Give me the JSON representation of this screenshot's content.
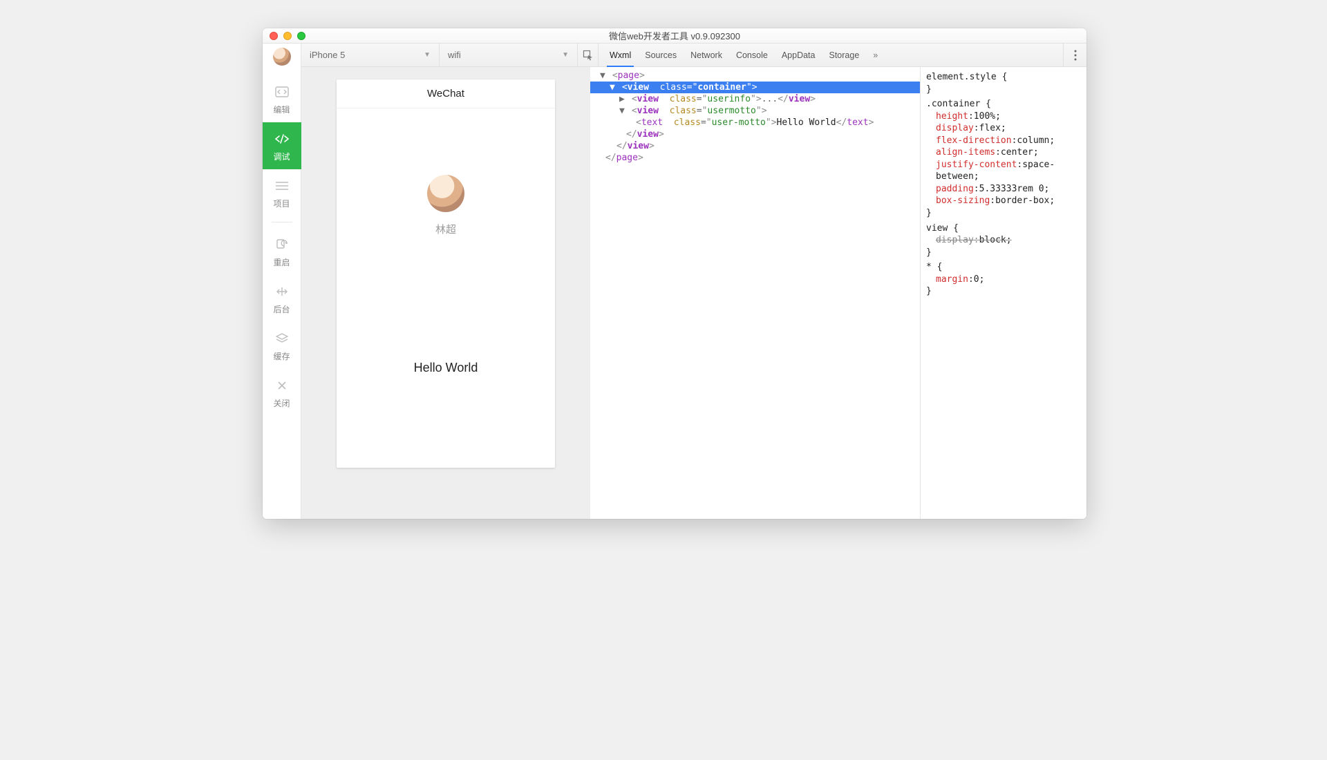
{
  "window": {
    "title": "微信web开发者工具 v0.9.092300"
  },
  "sidebar": {
    "items": [
      {
        "label": "编辑"
      },
      {
        "label": "调试"
      },
      {
        "label": "项目"
      },
      {
        "label": "重启"
      },
      {
        "label": "后台"
      },
      {
        "label": "缓存"
      },
      {
        "label": "关闭"
      }
    ]
  },
  "toolbar": {
    "device": "iPhone 5",
    "network": "wifi"
  },
  "devtools_tabs": [
    "Wxml",
    "Sources",
    "Network",
    "Console",
    "AppData",
    "Storage"
  ],
  "preview": {
    "page_title": "WeChat",
    "username": "林超",
    "motto": "Hello World"
  },
  "dom_tree": {
    "page_tag": "page",
    "container_tag": "view",
    "container_class": "container",
    "userinfo_tag": "view",
    "userinfo_class": "userinfo",
    "usermotto_tag": "view",
    "usermotto_class": "usermotto",
    "text_tag": "text",
    "text_class": "user-motto",
    "text_content": "Hello World",
    "attr_class": "class"
  },
  "styles": {
    "element_style_label": "element.style",
    "container_selector": ".container",
    "container_decls": [
      {
        "prop": "height",
        "val": "100%;"
      },
      {
        "prop": "display",
        "val": "flex;"
      },
      {
        "prop": "flex-direction",
        "val": "column;"
      },
      {
        "prop": "align-items",
        "val": "center;"
      },
      {
        "prop": "justify-content",
        "val": "space-between;"
      },
      {
        "prop": "padding",
        "val": "5.33333rem 0;"
      },
      {
        "prop": "box-sizing",
        "val": "border-box;"
      }
    ],
    "view_selector": "view",
    "view_decl": {
      "prop": "display",
      "val": "block;"
    },
    "star_selector": "*",
    "star_decl": {
      "prop": "margin",
      "val": "0;"
    },
    "brace_open": " {",
    "brace_close": "}"
  }
}
